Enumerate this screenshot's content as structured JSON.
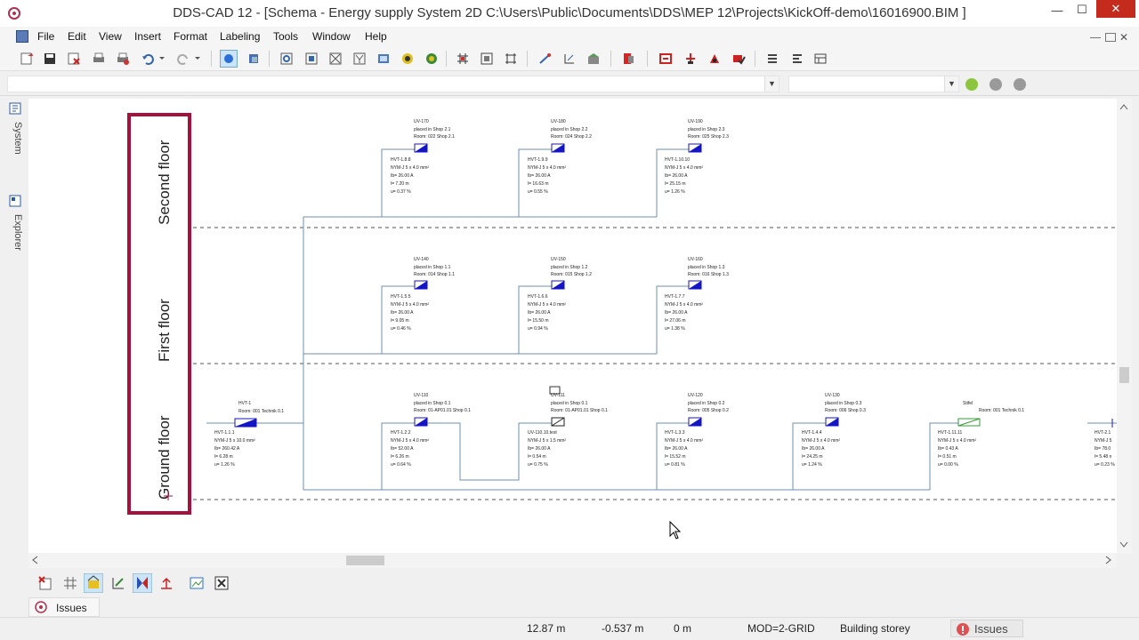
{
  "window": {
    "title": "DDS-CAD 12 - [Schema - Energy supply System  2D  C:\\Users\\Public\\Documents\\DDS\\MEP 12\\Projects\\KickOff-demo\\16016900.BIM ]"
  },
  "menu": [
    "File",
    "Edit",
    "View",
    "Insert",
    "Format",
    "Labeling",
    "Tools",
    "Window",
    "Help"
  ],
  "side_tabs": [
    "System",
    "Explorer"
  ],
  "floors": [
    "Second floor",
    "First floor",
    "Ground floor"
  ],
  "main_distributor": {
    "id": "HVT-1",
    "room": "Room: 001 Technik 0.1",
    "lines": [
      "HVT-1.1.1",
      "NYM-J 5 x 10.0 mm²",
      "Ib= 260.42 A",
      "l= 6.28 m",
      "u= 1.26 %"
    ]
  },
  "distributors": [
    {
      "id": "UV-170",
      "placed": "placed in Shop 2.1",
      "room": "Room: 022 Shop 2.1",
      "lines": [
        "HVT-1.8.8",
        "NYM-J 5 x 4.0 mm²",
        "Ib= 26.00 A",
        "l= 7.20 m",
        "u= 0.37 %"
      ]
    },
    {
      "id": "UV-180",
      "placed": "placed in Shop 2.2",
      "room": "Room: 024 Shop 2.2",
      "lines": [
        "HVT-1.9.9",
        "NYM-J 5 x 4.0 mm²",
        "Ib= 26.00 A",
        "l= 16.63 m",
        "u= 0.55 %"
      ]
    },
    {
      "id": "UV-190",
      "placed": "placed in Shop 2.3",
      "room": "Room: 025 Shop 2.3",
      "lines": [
        "HVT-1.10.10",
        "NYM-J 5 x 4.0 mm²",
        "Ib= 26.00 A",
        "l= 25.15 m",
        "u= 1.26 %"
      ]
    },
    {
      "id": "UV-140",
      "placed": "placed in Shop 1.1",
      "room": "Room: 014 Shop 1.1",
      "lines": [
        "HVT-1.5.5",
        "NYM-J 5 x 4.0 mm²",
        "Ib= 26.00 A",
        "l= 9.05 m",
        "u= 0.46 %"
      ]
    },
    {
      "id": "UV-150",
      "placed": "placed in Shop 1.2",
      "room": "Room: 015 Shop 1.2",
      "lines": [
        "HVT-1.6.6",
        "NYM-J 5 x 4.0 mm²",
        "Ib= 26.00 A",
        "l= 15.50 m",
        "u= 0.94 %"
      ]
    },
    {
      "id": "UV-160",
      "placed": "placed in Shop 1.3",
      "room": "Room: 016 Shop 1.3",
      "lines": [
        "HVT-1.7.7",
        "NYM-J 5 x 4.0 mm²",
        "Ib= 26.00 A",
        "l= 27.06 m",
        "u= 1.38 %"
      ]
    },
    {
      "id": "UV-110",
      "placed": "placed in Shop 0.1",
      "room": "Room: 01-AP01.01 Shop 0.1",
      "lines": [
        "HVT-1.2.2",
        "NYM-J 5 x 4.0 mm²",
        "Ib= 52.00 A",
        "l= 6.26 m",
        "u= 0.64 %"
      ]
    },
    {
      "id": "UV-111",
      "placed": "placed in Shop 0.1",
      "room": "Room: 01-AP01.01 Shop 0.1",
      "lines": [
        "UV-110.10.test",
        "NYM-J 5 x 1.5 mm²",
        "Ib= 26.00 A",
        "l= 0.54 m",
        "u= 0.75 %"
      ]
    },
    {
      "id": "UV-120",
      "placed": "placed in Shop 0.2",
      "room": "Room: 005 Shop 0.2",
      "lines": [
        "HVT-1.3.3",
        "NYM-J 5 x 4.0 mm²",
        "Ib= 26.00 A",
        "l= 15.52 m",
        "u= 0.81 %"
      ]
    },
    {
      "id": "UV-130",
      "placed": "placed in Shop 0.3",
      "room": "Room: 006 Shop 0.3",
      "lines": [
        "HVT-1.4.4",
        "NYM-J 5 x 4.0 mm²",
        "Ib= 26.00 A",
        "l= 24.25 m",
        "u= 1.24 %"
      ]
    },
    {
      "id": "Stifel",
      "placed": "",
      "room": "Room: 001 Technik 0.1",
      "lines": [
        "HVT-1.11.11",
        "NYM-J 5 x 4.0 mm²",
        "Ib= 0.43 A",
        "l= 0.51 m",
        "u= 0.00 %"
      ]
    },
    {
      "id": "",
      "placed": "",
      "room": "",
      "lines": [
        "HVT-2.1",
        "NYM-J 5",
        "Ib= 78.0",
        "l= 5.48 n",
        "u= 0.23 %"
      ]
    }
  ],
  "issues_tab": "Issues",
  "status": {
    "x": "12.87 m",
    "y": "-0.537 m",
    "z": "0 m",
    "mode": "MOD=2-GRID",
    "context": "Building storey",
    "issues": "Issues"
  },
  "colors": {
    "floor_frame": "#a3113c",
    "wire": "#6e8fb5",
    "symbol": "#1515c8",
    "close": "#c42b1c"
  }
}
